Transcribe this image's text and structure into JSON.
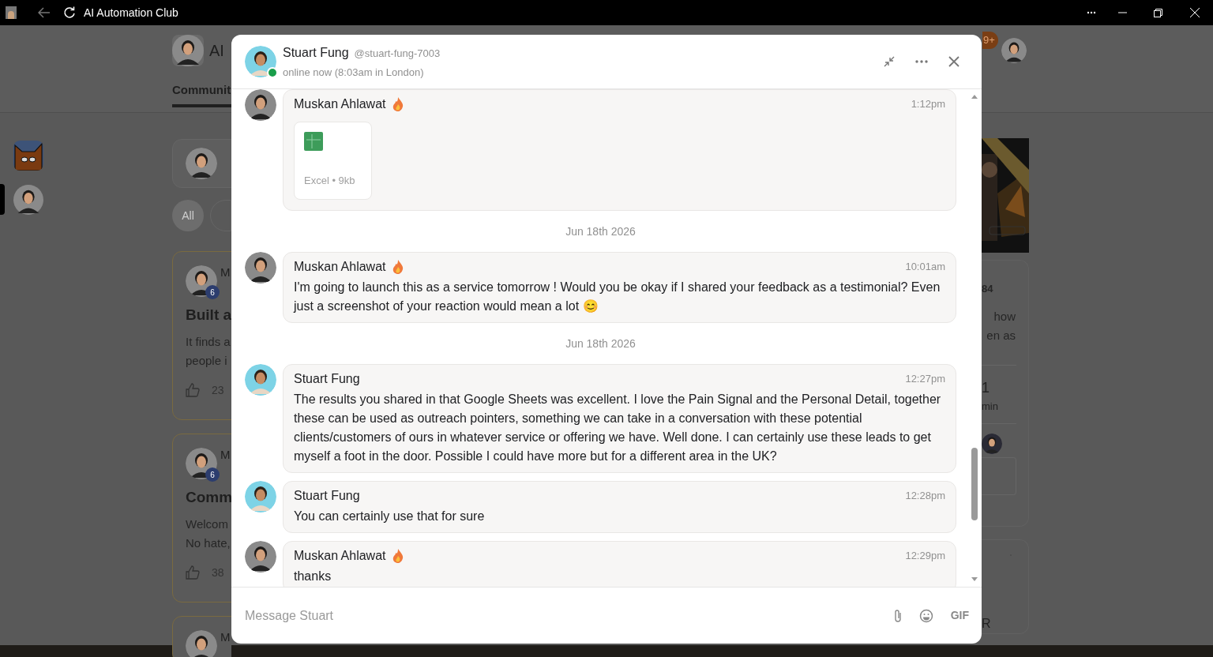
{
  "window": {
    "title": "AI Automation Club"
  },
  "background": {
    "logo_text": "AI",
    "tab": "Communit",
    "notification_count": "9+",
    "filter": "All",
    "posts": [
      {
        "author": "M",
        "level_badge": "6",
        "title": "Built a",
        "lines": [
          "It finds a",
          "people i"
        ],
        "likes": "23"
      },
      {
        "author": "M",
        "level_badge": "6",
        "title": "Comm",
        "lines": [
          "Welcom",
          "No hate,"
        ],
        "likes": "38"
      },
      {
        "author": "M"
      }
    ],
    "side_panel": {
      "count": "84",
      "lines": [
        "how",
        "en as"
      ],
      "stat": "1",
      "stat_label": "min",
      "footer": "R"
    }
  },
  "chat": {
    "contact": {
      "name": "Stuart Fung",
      "handle": "@stuart-fung-7003",
      "status": "online now (8:03am in London)",
      "online": true
    },
    "messages": [
      {
        "kind": "attachment",
        "author": "Muskan Ahlawat",
        "color": "#8a8a8a",
        "flame": true,
        "time": "1:12pm",
        "file": "Excel • 9kb"
      },
      {
        "kind": "date",
        "text": "Jun 18th 2026"
      },
      {
        "kind": "message",
        "author": "Muskan Ahlawat",
        "color": "#8a8a8a",
        "flame": true,
        "time": "10:01am",
        "text": "I'm going to launch this as a service tomorrow ! Would you be okay if I shared your feedback as a testimonial? Even just a screenshot of your reaction would mean a lot 😊"
      },
      {
        "kind": "date",
        "text": "Jun 18th 2026"
      },
      {
        "kind": "message",
        "author": "Stuart Fung",
        "color": "#7dd3e6",
        "flame": false,
        "time": "12:27pm",
        "text": "The results you shared in that Google Sheets was excellent. I love the Pain Signal and the Personal Detail, together these can be used as outreach pointers, something we can take in a conversation with these potential clients/customers of ours in whatever service or offering we have. Well done. I can certainly use these leads to get myself a foot in the door. Possible I could have more but for a different area in the UK?"
      },
      {
        "kind": "message",
        "author": "Stuart Fung",
        "color": "#7dd3e6",
        "flame": false,
        "time": "12:28pm",
        "text": "You can certainly use that for sure"
      },
      {
        "kind": "message",
        "author": "Muskan Ahlawat",
        "color": "#8a8a8a",
        "flame": true,
        "time": "12:29pm",
        "text": "thanks"
      }
    ],
    "composer": {
      "placeholder": "Message Stuart",
      "gif": "GIF"
    }
  }
}
